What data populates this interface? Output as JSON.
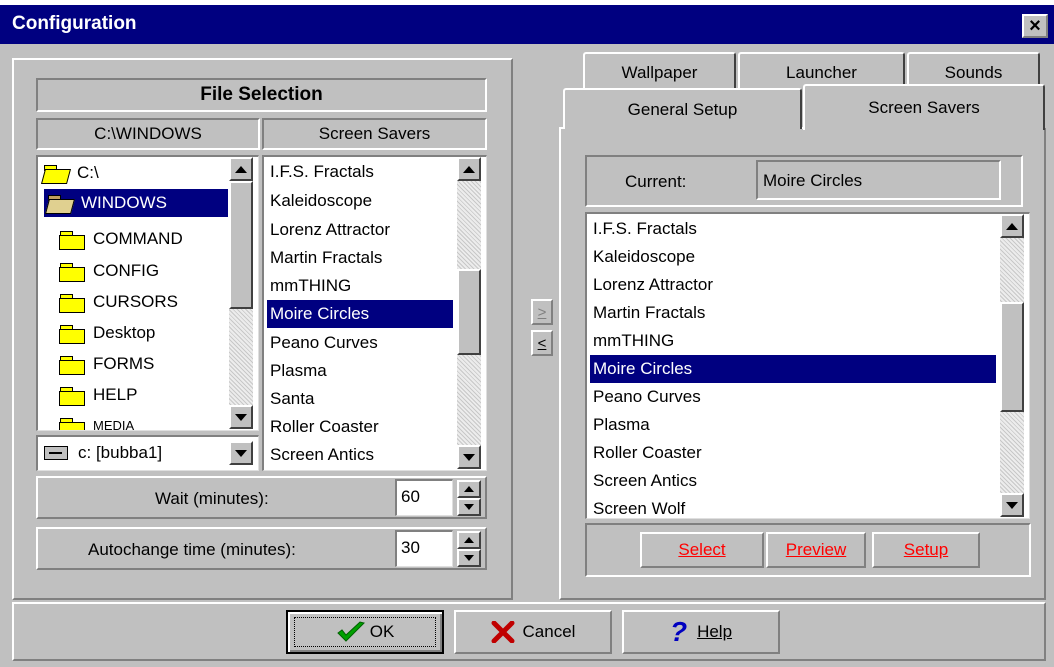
{
  "window": {
    "title": "Configuration",
    "close_glyph": "×"
  },
  "file_selection": {
    "header": "File Selection",
    "current_dir": "C:\\WINDOWS",
    "category": "Screen Savers",
    "folders": [
      {
        "label": "C:\\",
        "icon": "open-folder-icon"
      },
      {
        "label": "WINDOWS",
        "icon": "open-folder-icon",
        "selected": true
      },
      {
        "label": "COMMAND",
        "icon": "folder-icon"
      },
      {
        "label": "CONFIG",
        "icon": "folder-icon"
      },
      {
        "label": "CURSORS",
        "icon": "folder-icon"
      },
      {
        "label": "Desktop",
        "icon": "folder-icon"
      },
      {
        "label": "FORMS",
        "icon": "folder-icon"
      },
      {
        "label": "HELP",
        "icon": "folder-icon"
      },
      {
        "label": "MEDIA",
        "icon": "folder-icon"
      }
    ],
    "files": [
      "I.F.S. Fractals",
      "Kaleidoscope",
      "Lorenz Attractor",
      "Martin Fractals",
      "mmTHING",
      "Moire Circles",
      "Peano Curves",
      "Plasma",
      "Santa",
      "Roller Coaster",
      "Screen Antics"
    ],
    "selected_file": "Moire Circles",
    "drive": "c: [bubba1]",
    "wait_label": "Wait (minutes):",
    "wait_value": "60",
    "autochange_label": "Autochange time (minutes):",
    "autochange_value": "30"
  },
  "move_buttons": {
    "add": ">",
    "remove": "<"
  },
  "tabs": {
    "row1": [
      "Wallpaper",
      "Launcher",
      "Sounds"
    ],
    "row2": [
      "General Setup",
      "Screen Savers"
    ],
    "active": "Screen Savers"
  },
  "screen_savers": {
    "current_label": "Current:",
    "current_value": "Moire Circles",
    "items": [
      "I.F.S. Fractals",
      "Kaleidoscope",
      "Lorenz Attractor",
      "Martin Fractals",
      "mmTHING",
      "Moire Circles",
      "Peano Curves",
      "Plasma",
      "Roller Coaster",
      "Screen Antics",
      "Screen Wolf"
    ],
    "selected": "Moire Circles",
    "buttons": {
      "select": "Select",
      "preview": "Preview",
      "setup": "Setup"
    }
  },
  "footer": {
    "ok": "OK",
    "cancel": "Cancel",
    "help": "Help"
  },
  "colors": {
    "face": "#c0c0c0",
    "title_bar": "#000080",
    "selection": "#000080",
    "accent_text": "#ff0000"
  }
}
